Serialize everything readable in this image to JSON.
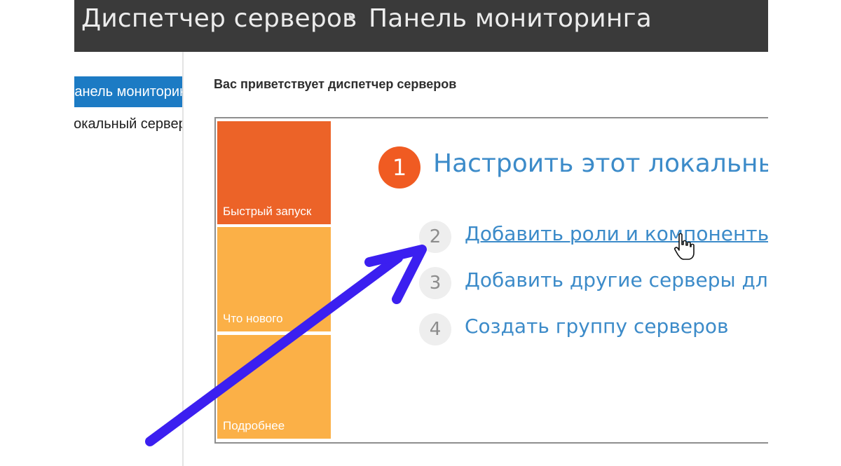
{
  "titlebar": {
    "root": "Диспетчер серверов",
    "separator": "▸",
    "current": "Панель мониторинга"
  },
  "sidebar": {
    "items": [
      {
        "label": "Панель мониторинга",
        "active": true
      },
      {
        "label": "Локальный сервер",
        "active": false
      }
    ]
  },
  "welcome": {
    "heading": "Вас приветствует диспетчер серверов",
    "tiles": [
      {
        "label": "Быстрый запуск"
      },
      {
        "label": "Что нового"
      },
      {
        "label": "Подробнее"
      }
    ],
    "main_step": {
      "number": "1",
      "title": "Настроить этот локальный сервер"
    },
    "steps": [
      {
        "number": "2",
        "label": "Добавить роли и компоненты"
      },
      {
        "number": "3",
        "label": "Добавить другие серверы для управления"
      },
      {
        "number": "4",
        "label": "Создать группу серверов"
      }
    ]
  },
  "colors": {
    "titlebar_bg": "#3a3a3a",
    "sidebar_active": "#1c7bc4",
    "tile_quick": "#ec6328",
    "tile_other": "#fbb047",
    "link": "#3c8bc9",
    "annotation_arrow": "#3b1ff0"
  },
  "icons": {
    "cursor": "hand-pointer-icon",
    "annotation": "arrow-annotation-icon"
  }
}
